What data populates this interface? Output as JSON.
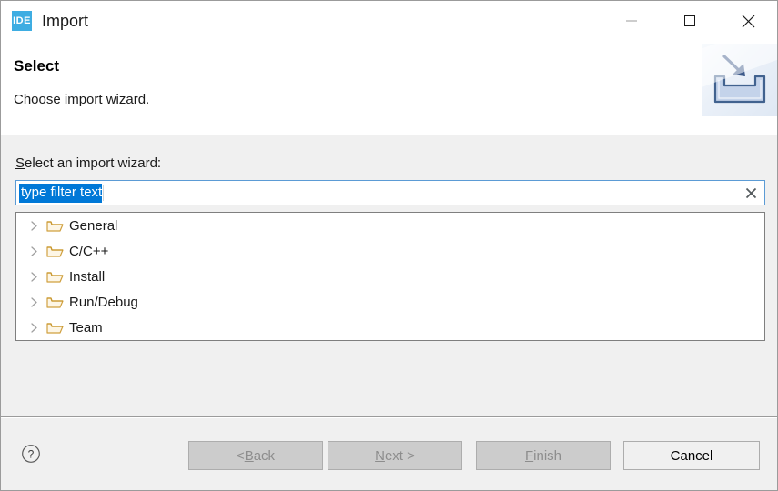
{
  "window": {
    "app_icon_label": "IDE",
    "title": "Import",
    "controls": {
      "minimize": "minimize-icon",
      "maximize": "maximize-icon",
      "close": "close-icon"
    }
  },
  "header": {
    "title": "Select",
    "subtitle": "Choose import wizard.",
    "banner_icon": "import-tray-arrow-icon"
  },
  "main": {
    "field_label_prefix": "S",
    "field_label_rest": "elect an import wizard:",
    "filter": {
      "value": "type filter text",
      "placeholder": "type filter text",
      "selected": true,
      "clear_icon": "clear-x-icon"
    },
    "tree": {
      "items": [
        {
          "label": "General",
          "expanded": false,
          "icon": "folder-icon"
        },
        {
          "label": "C/C++",
          "expanded": false,
          "icon": "folder-icon"
        },
        {
          "label": "Install",
          "expanded": false,
          "icon": "folder-icon"
        },
        {
          "label": "Run/Debug",
          "expanded": false,
          "icon": "folder-icon"
        },
        {
          "label": "Team",
          "expanded": false,
          "icon": "folder-icon"
        }
      ]
    }
  },
  "footer": {
    "help_icon": "help-question-icon",
    "buttons": {
      "back": {
        "pre": "< ",
        "mnemonic": "B",
        "post": "ack",
        "enabled": false
      },
      "next": {
        "pre": "",
        "mnemonic": "N",
        "post": "ext >",
        "enabled": false
      },
      "finish": {
        "pre": "",
        "mnemonic": "F",
        "post": "inish",
        "enabled": false
      },
      "cancel": {
        "pre": "",
        "mnemonic": "",
        "post": "Cancel",
        "enabled": true
      }
    }
  },
  "colors": {
    "selection_blue": "#0078d7",
    "accent_icon": "#3eade2",
    "folder_orange": "#d9a441",
    "body_grey": "#f0f0f0"
  }
}
